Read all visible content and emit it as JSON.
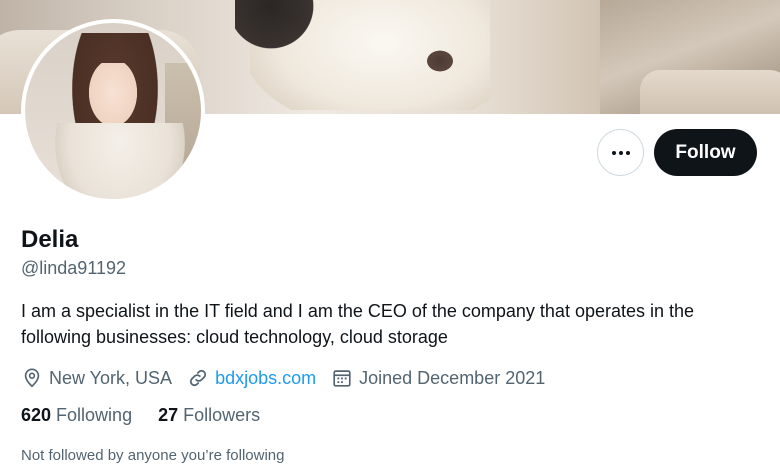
{
  "profile": {
    "name": "Delia",
    "handle": "@linda91192",
    "bio": "I am a specialist in the IT field and I am the CEO of the company that operates in the following businesses: cloud technology, cloud storage",
    "location": "New York, USA",
    "website": "bdxjobs.com",
    "joined": "Joined December 2021"
  },
  "actions": {
    "more_icon": "more-horizontal-icon",
    "follow_label": "Follow"
  },
  "stats": {
    "following_count": "620",
    "following_label": "Following",
    "followers_count": "27",
    "followers_label": "Followers"
  },
  "footer": {
    "not_followed_text": "Not followed by anyone you’re following"
  },
  "icons": {
    "location": "location-pin-icon",
    "link": "link-icon",
    "calendar": "calendar-icon"
  },
  "colors": {
    "primary_text": "#0f1419",
    "secondary_text": "#536471",
    "link": "#1d9bf0",
    "follow_button_bg": "#0f1419",
    "border": "#cfd9de"
  }
}
